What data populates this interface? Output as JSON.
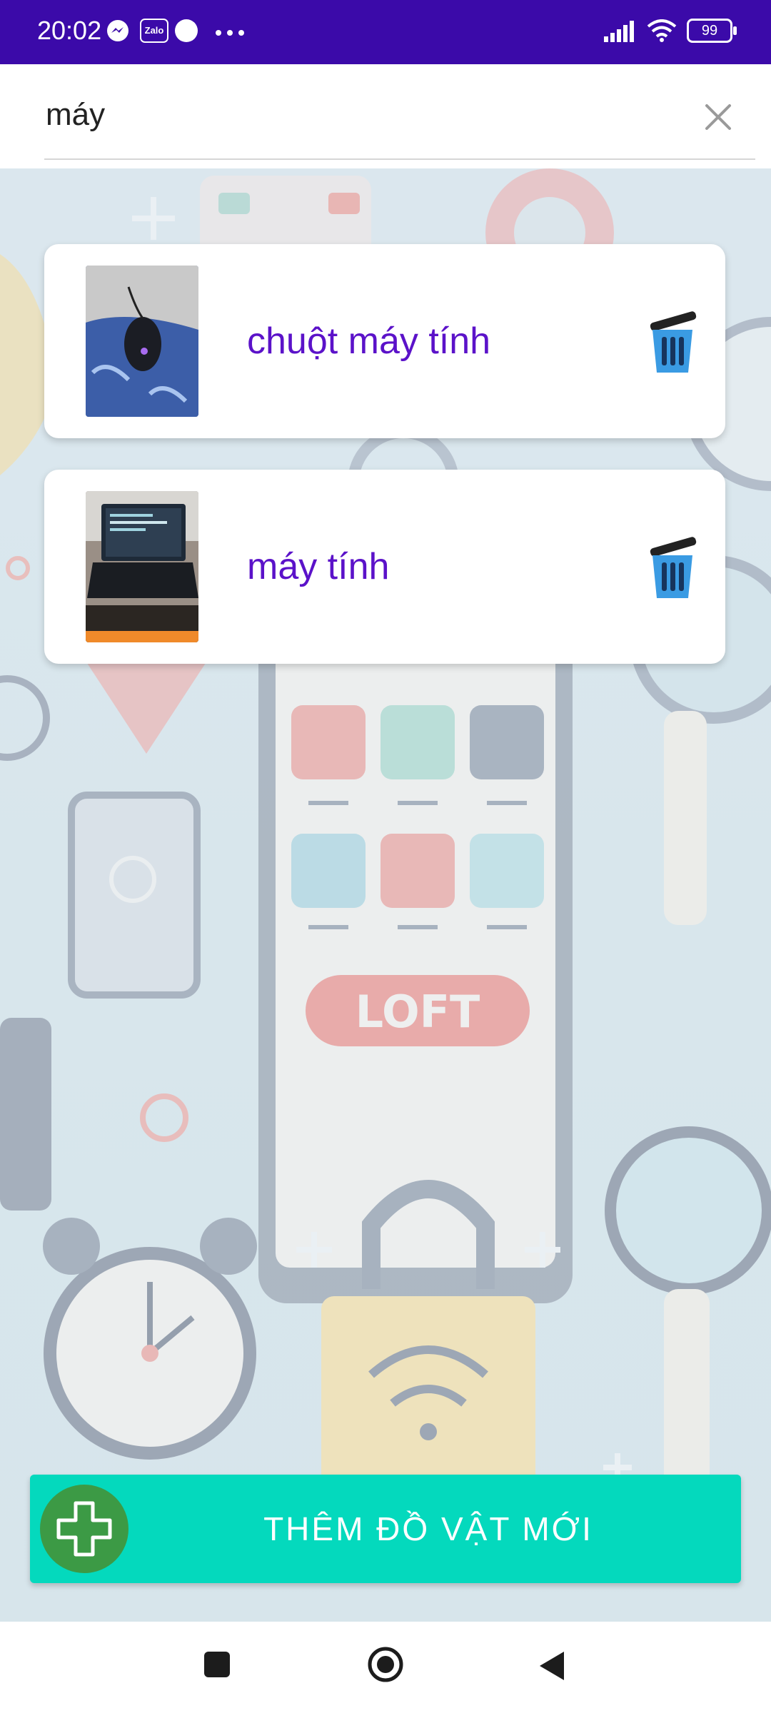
{
  "status_bar": {
    "time": "20:02",
    "apps": [
      "messenger-icon",
      "zalo-icon",
      "circle-icon",
      "more-icon"
    ],
    "zalo_label": "Zalo",
    "battery": "99"
  },
  "search": {
    "value": "máy",
    "clear_icon": "close-icon"
  },
  "items": [
    {
      "name": "chuột máy tính",
      "image": "mouse-photo"
    },
    {
      "name": "máy tính",
      "image": "laptop-photo"
    }
  ],
  "add_button": {
    "label": "THÊM ĐỒ VẬT MỚI",
    "icon": "plus-icon"
  },
  "colors": {
    "status_bar": "#3b0aa9",
    "item_text": "#5b12c9",
    "trash": "#2b8ad6",
    "add_button": "#04d9bd",
    "add_icon_bg": "#3c9a45"
  },
  "nav": [
    "recents-button",
    "home-button",
    "back-button"
  ]
}
